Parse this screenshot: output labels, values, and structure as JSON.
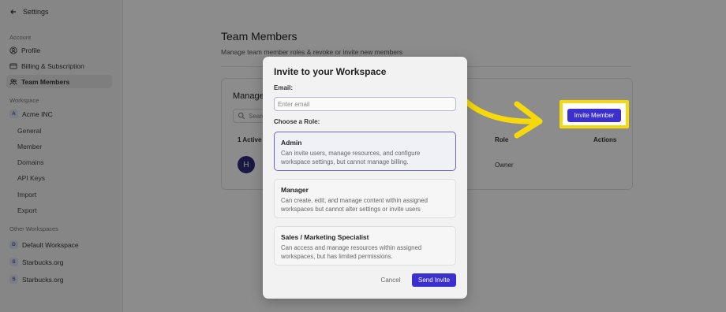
{
  "sidebar": {
    "back_label": "Settings",
    "account_heading": "Account",
    "account_items": [
      {
        "label": "Profile",
        "icon": "user-circle-icon"
      },
      {
        "label": "Billing & Subscription",
        "icon": "credit-card-icon"
      },
      {
        "label": "Team Members",
        "icon": "users-icon",
        "active": true
      }
    ],
    "workspace_heading": "Workspace",
    "workspace": {
      "badge": "A",
      "name": "Acme INC"
    },
    "workspace_items": [
      "General",
      "Member",
      "Domains",
      "API Keys",
      "Import",
      "Export"
    ],
    "other_heading": "Other Workspaces",
    "other_workspaces": [
      {
        "badge": "D",
        "name": "Default Workspace"
      },
      {
        "badge": "S",
        "name": "Starbucks.org"
      },
      {
        "badge": "S",
        "name": "Starbucks.org"
      }
    ]
  },
  "main": {
    "title": "Team Members",
    "subtitle": "Manage team member roles & revoke or invite new members",
    "card_title": "Manage Members",
    "search_placeholder": "Search",
    "invite_button": "Invite Member",
    "columns": {
      "active": "1 Active",
      "role": "Role",
      "actions": "Actions"
    },
    "member": {
      "avatar": "H",
      "role": "Owner"
    }
  },
  "modal": {
    "title": "Invite to your Workspace",
    "email_label": "Email:",
    "email_placeholder": "Enter email",
    "role_label": "Choose a Role:",
    "roles": [
      {
        "name": "Admin",
        "description": "Can invite users, manage resources, and configure workspace settings, but cannot manage billing.",
        "selected": true
      },
      {
        "name": "Manager",
        "description": "Can create, edit, and manage content within assigned workspaces but cannot alter settings or invite users",
        "selected": false
      },
      {
        "name": "Sales / Marketing Specialist",
        "description": "Can access and manage resources within assigned workspaces, but has limited permissions.",
        "selected": false
      }
    ],
    "cancel_label": "Cancel",
    "send_label": "Send Invite"
  },
  "annotation": {
    "highlight_color": "#f5d90a",
    "arrow_color": "#f5d90a"
  },
  "colors": {
    "accent": "#3b2fd0",
    "selected_border": "#6d63c9"
  }
}
